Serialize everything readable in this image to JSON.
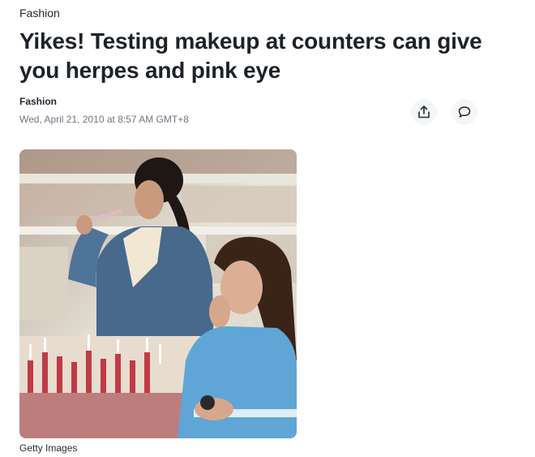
{
  "article": {
    "category": "Fashion",
    "headline": "Yikes! Testing makeup at counters can give you herpes and pink eye",
    "byline": "Fashion",
    "timestamp": "Wed, April 21, 2010 at 8:57 AM GMT+8"
  },
  "actions": {
    "share_icon": "share-icon",
    "comment_icon": "comment-icon"
  },
  "image": {
    "caption": "Getty Images"
  },
  "colors": {
    "text": "#232a31",
    "muted": "#6e7780",
    "button_bg": "#f5f6f7"
  }
}
